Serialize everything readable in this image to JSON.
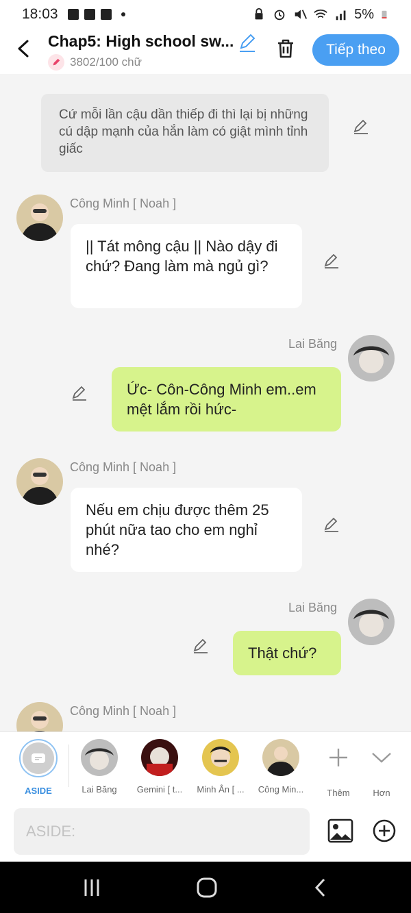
{
  "status_bar": {
    "time": "18:03",
    "battery": "5%"
  },
  "header": {
    "title": "Chap5: High school sw...",
    "word_count": "3802/100 chữ",
    "next_label": "Tiếp theo"
  },
  "chat": {
    "narration": "Cứ mỗi lần cậu dần thiếp đi thì lại bị những cú dập mạnh của hắn làm có giật mình tỉnh giấc",
    "messages": [
      {
        "name": "Công Minh [ Noah ]",
        "text": "|| Tát mông cậu || Nào dậy đi chứ? Đang làm mà ngủ gì?"
      },
      {
        "name": "Lai Băng",
        "text": "Ức- Côn-Công Minh em..em mệt lắm rồi hức-"
      },
      {
        "name": "Công Minh [ Noah ]",
        "text": "Nếu em chịu được thêm 25 phút nữa tao cho em nghỉ nhé?"
      },
      {
        "name": "Lai Băng",
        "text": "Thật chứ?"
      },
      {
        "name": "Công Minh [ Noah ]"
      }
    ]
  },
  "characters": {
    "aside": "ASIDE",
    "items": [
      {
        "label": "Lai Băng"
      },
      {
        "label": "Gemini [ t..."
      },
      {
        "label": "Minh Ân [ ..."
      },
      {
        "label": "Công Min..."
      }
    ],
    "more_label": "Thêm",
    "collapse_label": "Hơn"
  },
  "input": {
    "placeholder": "ASIDE:"
  },
  "colors": {
    "accent": "#4a9ff2",
    "green_bubble": "#d7f38c",
    "narration_bg": "#e8e8e8"
  }
}
